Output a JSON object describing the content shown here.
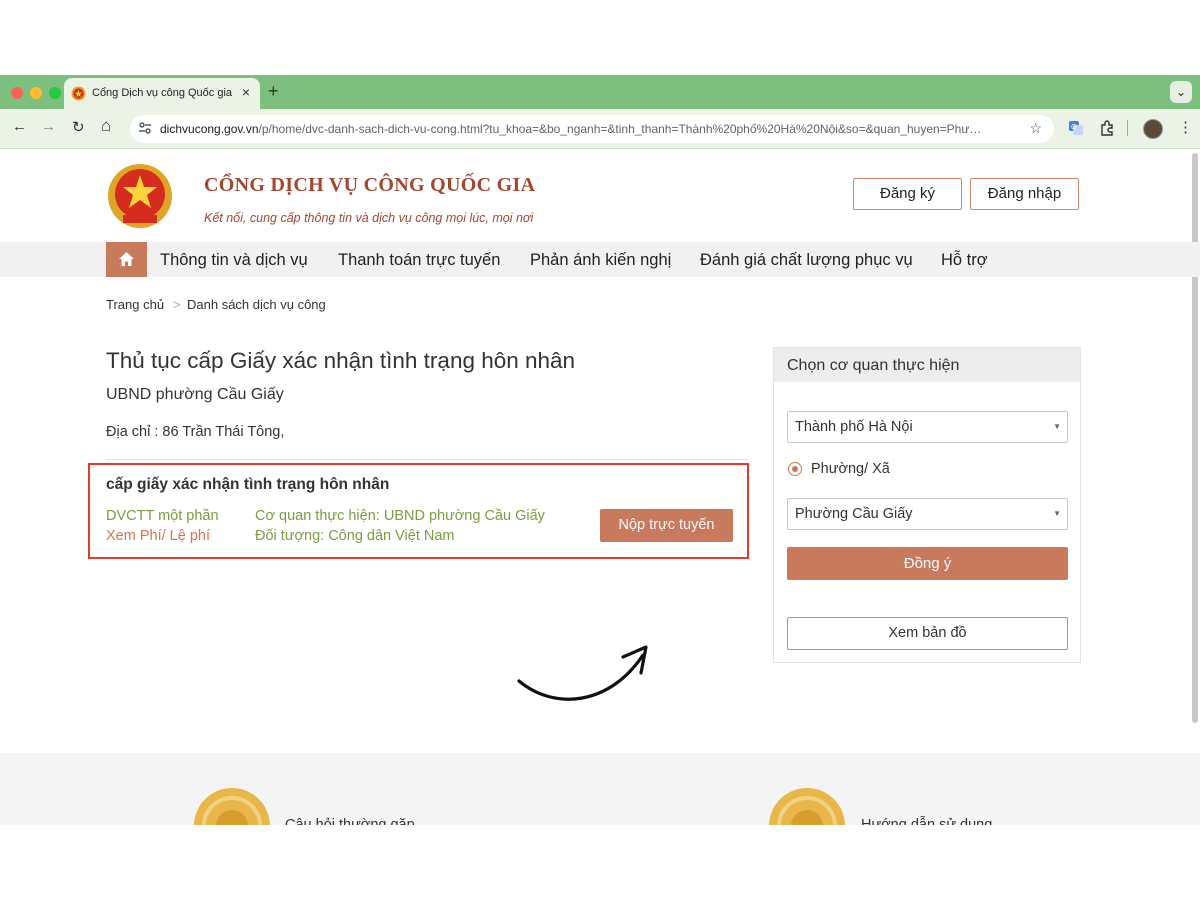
{
  "browser": {
    "tab_title": "Cổng Dịch vụ công Quốc gia",
    "tab_close": "×",
    "new_tab": "+",
    "tab_menu": "⌄",
    "url_host": "dichvucong.gov.vn",
    "url_path": "/p/home/dvc-danh-sach-dich-vu-cong.html?tu_khoa=&bo_nganh=&tinh_thanh=Thành%20phố%20Hà%20Nội&so=&quan_huyen=Phư…",
    "nav_back": "←",
    "nav_forward": "→",
    "nav_reload": "↻",
    "nav_home": "⌂",
    "star": "☆",
    "menu": "⋮",
    "colors": {
      "frame": "#7dbf7f",
      "toolbar": "#eaf3e6"
    }
  },
  "header": {
    "logo_main": "CỔNG DỊCH VỤ CÔNG QUỐC GIA",
    "logo_tagline": "Kết nối, cung cấp thông tin và dịch vụ công mọi lúc, mọi nơi",
    "register_label": "Đăng ký",
    "login_label": "Đăng nhập"
  },
  "nav": {
    "home_icon": "home-icon",
    "items": [
      {
        "label": "Thông tin và dịch vụ"
      },
      {
        "label": "Thanh toán trực tuyến"
      },
      {
        "label": "Phản ánh kiến nghị"
      },
      {
        "label": "Đánh giá chất lượng phục vụ"
      },
      {
        "label": "Hỗ trợ"
      }
    ]
  },
  "breadcrumb": {
    "home": "Trang chủ",
    "separator": ">",
    "current": "Danh sách dịch vụ công"
  },
  "main": {
    "title": "Thủ tục cấp Giấy xác nhận tình trạng hôn nhân",
    "agency": "UBND phường Cầu Giấy",
    "address": "Địa chỉ : 86 Trần Thái Tông,",
    "service": {
      "name": "cấp giấy xác nhận tình trạng hôn nhân",
      "level": "DVCTT một phần",
      "fee_link": "Xem Phí/ Lệ phí",
      "agency": "Cơ quan thực hiện: UBND phường Cầu Giấy",
      "audience": "Đối tượng: Công dân Việt Nam",
      "submit_label": "Nộp trực tuyến"
    }
  },
  "sidebar": {
    "title": "Chọn cơ quan thực hiện",
    "province_value": "Thành phố Hà Nội",
    "radio_label": "Phường/ Xã",
    "ward_value": "Phường Cầu Giấy",
    "agree_label": "Đồng ý",
    "map_label": "Xem bản đồ"
  },
  "footer": {
    "faq_label": "Câu hỏi thường gặp",
    "guide_label": "Hướng dẫn sử dụng"
  },
  "colors": {
    "accent": "#c97a5c",
    "highlight_border": "#e53929",
    "green_text": "#7a9d3f",
    "orange_text": "#d9734f",
    "brand_red": "#a3472f"
  }
}
